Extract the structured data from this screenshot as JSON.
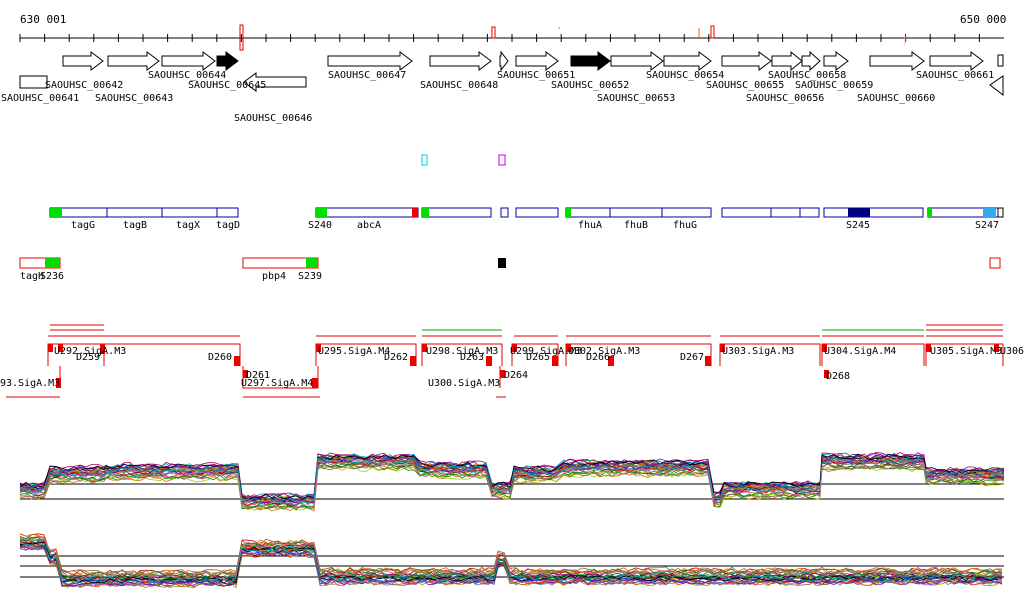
{
  "coordinates": {
    "start": "630 001",
    "end": "650 000"
  },
  "genes_top_row": [
    {
      "label": "SAOUHSC_00642",
      "dir": "right",
      "fill": "white"
    },
    {
      "label": "SAOUHSC_00643",
      "dir": "right",
      "fill": "white"
    },
    {
      "label": "SAOUHSC_00644",
      "dir": "right",
      "fill": "white"
    },
    {
      "label": "SAOUHSC_00645",
      "dir": "right",
      "fill": "black"
    },
    {
      "label": "SAOUHSC_00647",
      "dir": "right",
      "fill": "white"
    },
    {
      "label": "SAOUHSC_00648",
      "dir": "right",
      "fill": "white"
    },
    {
      "label": "SAOUHSC_00651",
      "dir": "right",
      "fill": "white"
    },
    {
      "label": "SAOUHSC_00652",
      "dir": "right",
      "fill": "black"
    },
    {
      "label": "SAOUHSC_00653",
      "dir": "right",
      "fill": "white"
    },
    {
      "label": "SAOUHSC_00654",
      "dir": "right",
      "fill": "white"
    },
    {
      "label": "SAOUHSC_00655",
      "dir": "right",
      "fill": "white"
    },
    {
      "label": "SAOUHSC_00656",
      "dir": "right",
      "fill": "white"
    },
    {
      "label": "SAOUHSC_00658",
      "dir": "right",
      "fill": "white"
    },
    {
      "label": "SAOUHSC_00659",
      "dir": "right",
      "fill": "white"
    },
    {
      "label": "SAOUHSC_00660",
      "dir": "right",
      "fill": "white"
    },
    {
      "label": "SAOUHSC_00661",
      "dir": "right",
      "fill": "white"
    }
  ],
  "genes_other": [
    {
      "label": "SAOUHSC_00641",
      "dir": "none"
    },
    {
      "label": "SAOUHSC_00646",
      "dir": "left"
    }
  ],
  "operons_row1": [
    "tagG",
    "tagB",
    "tagX",
    "tagD",
    "S240",
    "abcA",
    "fhuA",
    "fhuB",
    "fhuG",
    "S245",
    "S247"
  ],
  "operons_row2": [
    "tagH",
    "S236",
    "pbp4",
    "S239"
  ],
  "transcripts_upper": [
    "U292.SigA.M3",
    "D259",
    "D260",
    "U295.SigA.M4",
    "D262",
    "U298.SigA.M3",
    "D263",
    "U299.SigA.M3",
    "D265",
    "U302.SigA.M3",
    "D266",
    "D267",
    "U303.SigA.M3",
    "U304.SigA.M4",
    "U305.SigA.M3",
    "U306."
  ],
  "transcripts_lower": [
    "93.SigA.M3",
    "D261",
    "U297.SigA.M4",
    "D264",
    "U300.SigA.M3",
    "D268"
  ],
  "colors": {
    "operon_outline": "#0000aa",
    "operon_start": "#00dd00",
    "operon_end": "#ee0000",
    "transcript_line": "#dd0000",
    "highlight_green": "#00aa00",
    "sigma_navy": "#000080",
    "sigma_sky": "#33aaee",
    "cyan_marker": "#00cccc",
    "magenta_marker": "#cc00cc"
  }
}
